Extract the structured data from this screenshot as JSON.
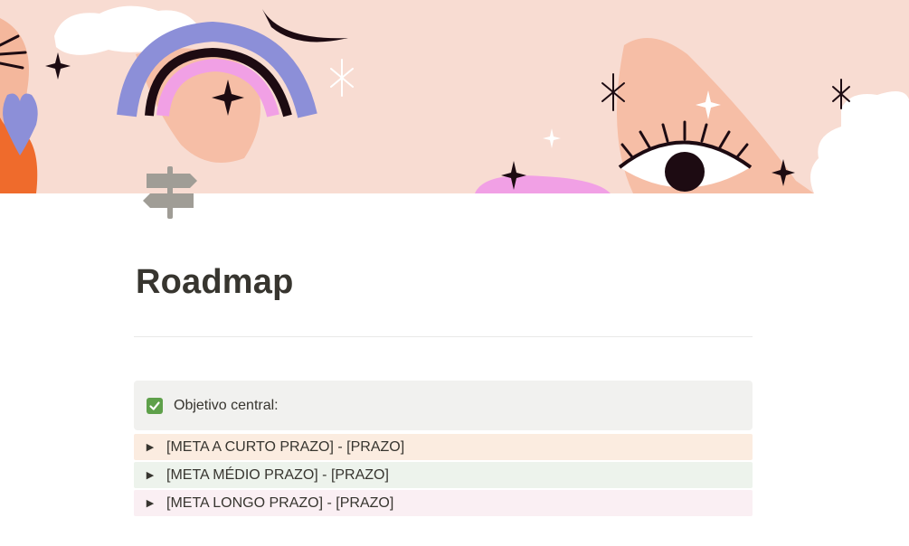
{
  "page": {
    "title": "Roadmap",
    "icon": "signpost-icon"
  },
  "callout": {
    "icon": "check-box-icon",
    "text": "Objetivo central:"
  },
  "toggles": [
    {
      "label": "[META A CURTO PRAZO] - [PRAZO]",
      "bg": "#fbece0"
    },
    {
      "label": "[META MÉDIO PRAZO] - [PRAZO]",
      "bg": "#edf3ec"
    },
    {
      "label": "[META LONGO PRAZO] - [PRAZO]",
      "bg": "#faeff3"
    }
  ],
  "colors": {
    "cover_bg": "#f8dcd2",
    "text": "#37352f",
    "callout_bg": "#f1f1ef",
    "check_green": "#5ea04a"
  }
}
